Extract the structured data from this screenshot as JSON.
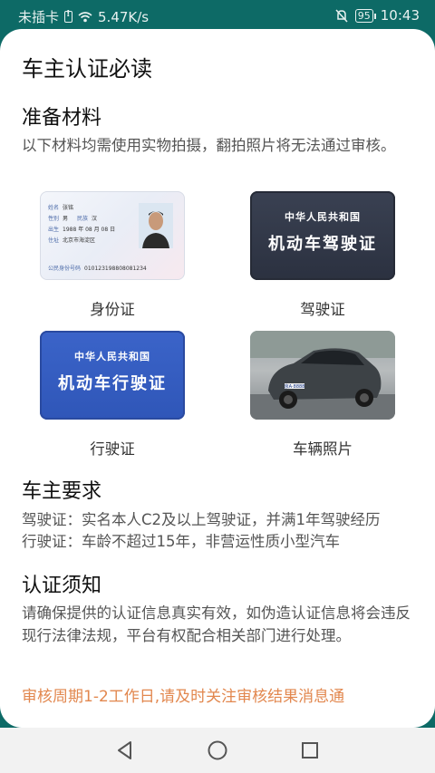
{
  "status_bar": {
    "carrier": "未插卡",
    "speed": "5.47K/s",
    "battery": "95",
    "time": "10:43"
  },
  "card": {
    "title": "车主认证必读",
    "materials": {
      "title": "准备材料",
      "desc": "以下材料均需使用实物拍摄，翻拍照片将无法通过审核。",
      "items": [
        {
          "label": "身份证"
        },
        {
          "label": "驾驶证",
          "line1": "中华人民共和国",
          "line2": "机动车驾驶证"
        },
        {
          "label": "行驶证",
          "line1": "中华人民共和国",
          "line2": "机动车行驶证"
        },
        {
          "label": "车辆照片"
        }
      ],
      "id_card": {
        "name_k": "姓名",
        "name_v": "张铭",
        "sex_k": "性别",
        "sex_v": "男",
        "nation_k": "民族",
        "nation_v": "汉",
        "birth_k": "出生",
        "birth_v": "1988 年 08 月 08 日",
        "addr_k": "住址",
        "addr_v": "北京市海淀区",
        "num_k": "公民身份号码",
        "num_v": "010123198808081234"
      },
      "plate": "京A·8888"
    },
    "owner_req": {
      "title": "车主要求",
      "line1": "驾驶证：实名本人C2及以上驾驶证，并满1年驾驶经历",
      "line2": "行驶证：车龄不超过15年，非营运性质小型汽车"
    },
    "notice": {
      "title": "认证须知",
      "text": "请确保提供的认证信息真实有效，如伪造认证信息将会违反现行法律法规，平台有权配合相关部门进行处理。",
      "cycle": "审核周期1-2工作日,请及时关注审核结果消息通"
    }
  },
  "colors": {
    "status_bg": "#0d6a66",
    "notice": "#e2874e",
    "dl_bg": "#2f3544",
    "vl_bg": "#345cc0"
  },
  "nav": {
    "icons": [
      "back-icon",
      "home-icon",
      "recents-icon"
    ]
  }
}
